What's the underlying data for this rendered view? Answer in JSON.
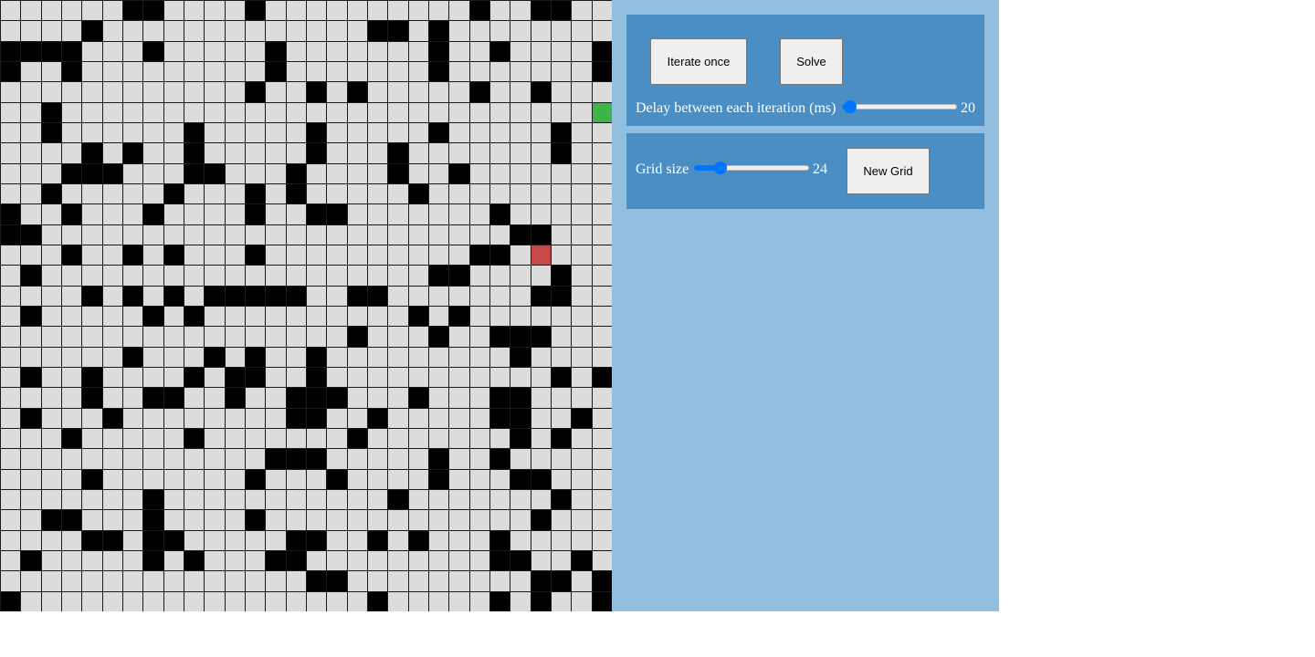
{
  "grid": {
    "size": 30,
    "start": {
      "row": 12,
      "col": 26
    },
    "goal": {
      "row": 5,
      "col": 29
    },
    "walls": [
      "......##....#..........#..##..",
      "....#.............##.#........",
      "####...#.....#.......#..#....#",
      "#..#.........#.......#.......#",
      "............#..#.#.....#..#...",
      "..#...........................",
      "..#......#.....#.....#.....#..",
      "....#.#..#.....#...#.......#..",
      "...###...##...#....#..#.......",
      "..#.....#...#.#.....#.........",
      "#..#...#....#..##.......#.....",
      "##.......................##...",
      "...#..#.#...#..........##.....",
      ".#...................##....#..",
      "....#.#.#.#####..##.......##..",
      ".#.....#.#..........#.#.......",
      ".................#...#..###...",
      "......#...#.#..#.........#....",
      ".#..#....#.##..#...........#.#",
      "....#..##..#..###...#...##....",
      ".#...#........##..#.....##..#.",
      "...#.....#.......#.......#.#..",
      ".............###.....#..#.....",
      "....#.......#...#....#...##...",
      ".......#...........#.......#..",
      "..##...#....#.............#...",
      "....##.##.....##..#.#...#.....",
      ".#.....#.#...##.........##..#.",
      "...............##.........##.#",
      "#.................#.....#.#..#"
    ]
  },
  "controls": {
    "iterate_label": "Iterate once",
    "solve_label": "Solve",
    "delay_label": "Delay between each iteration (ms)",
    "delay_value": "20",
    "delay_min": 0,
    "delay_max": 1000,
    "grid_size_label": "Grid size",
    "grid_size_value": "24",
    "grid_size_min": 5,
    "grid_size_max": 100,
    "new_grid_label": "New Grid"
  },
  "colors": {
    "cell_empty": "#dcdcdc",
    "cell_wall": "#000000",
    "cell_start": "#c84848",
    "cell_goal": "#3eb548",
    "grid_line": "#1a1a1a",
    "panel_bg": "#92bedf",
    "box_bg": "#4a8ec4",
    "slider_accent": "#0075ff"
  }
}
